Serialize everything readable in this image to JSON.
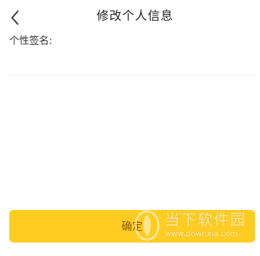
{
  "header": {
    "back_icon": "chevron-left-icon",
    "title": "修改个人信息"
  },
  "form": {
    "signature_label": "个性签名:",
    "signature_value": "",
    "signature_placeholder": ""
  },
  "footer": {
    "confirm_label": "确定",
    "confirm_color": "#ffcc22"
  },
  "watermark": {
    "logo_icon": "downxia-logo-icon",
    "name_cn": "当下软件园",
    "url": "www.downxia.com"
  }
}
